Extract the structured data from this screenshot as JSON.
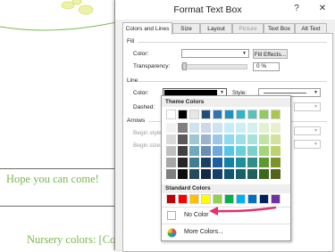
{
  "document": {
    "invite_text": "Hope you can come!",
    "bottom_text": "Nursery colors: [Colors"
  },
  "dialog": {
    "title": "Format Text Box",
    "help_glyph": "?",
    "close_glyph": "✕",
    "tabs": [
      {
        "label": "Colors and Lines",
        "active": true
      },
      {
        "label": "Size"
      },
      {
        "label": "Layout"
      },
      {
        "label": "Picture",
        "disabled": true
      },
      {
        "label": "Text Box"
      },
      {
        "label": "Alt Text"
      }
    ],
    "fill": {
      "section": "Fill",
      "color_label": "Color:",
      "fill_effects_label": "Fill Effects...",
      "transparency_label": "Transparency:",
      "transparency_value": "0 %",
      "transparency_fraction": 0
    },
    "line": {
      "section": "Line",
      "color_label": "Color:",
      "color_value": "#000000",
      "dashed_label": "Dashed:",
      "style_label": "Style:"
    },
    "arrows": {
      "section": "Arrows",
      "begin_style_label": "Begin style:",
      "begin_size_label": "Begin size:"
    }
  },
  "color_popup": {
    "theme_header": "Theme Colors",
    "theme_top_row": [
      "#ffffff",
      "#000000",
      "#e7e6e6",
      "#1f4e79",
      "#2e75b6",
      "#1e90c8",
      "#2fb5c8",
      "#5bc0be",
      "#8fcb5e",
      "#a9c84b"
    ],
    "theme_columns": [
      [
        "#f2f2f2",
        "#d9d9d9",
        "#bfbfbf",
        "#a6a6a6",
        "#7f7f7f"
      ],
      [
        "#7f7f7f",
        "#595959",
        "#404040",
        "#262626",
        "#0d0d0d"
      ],
      [
        "#cfe3ea",
        "#a0c6d4",
        "#6fa9be",
        "#3f7f95",
        "#244c5a"
      ],
      [
        "#cdd9e6",
        "#9bb3cd",
        "#6a8db4",
        "#1f3e63",
        "#132842"
      ],
      [
        "#cfe2f3",
        "#9fc5e8",
        "#6fa8dc",
        "#1e5fa1",
        "#143f6b"
      ],
      [
        "#c7ecf7",
        "#90d9ef",
        "#58c5e7",
        "#1581a6",
        "#0e566f"
      ],
      [
        "#cdeff3",
        "#9bdfe8",
        "#69cfdc",
        "#1f8f9e",
        "#155f69"
      ],
      [
        "#d3efee",
        "#a7e0dd",
        "#7bd0cc",
        "#2f8e8a",
        "#1f5f5c"
      ],
      [
        "#e1f1d2",
        "#c3e3a5",
        "#a5d578",
        "#5b9a2b",
        "#3d671d"
      ],
      [
        "#e9f0cf",
        "#d3e19f",
        "#bdd26f",
        "#7c932a",
        "#53621c"
      ]
    ],
    "standard_header": "Standard Colors",
    "standard": [
      "#c00000",
      "#ff0000",
      "#ffc000",
      "#ffff00",
      "#92d050",
      "#00b050",
      "#00b0f0",
      "#0070c0",
      "#002060",
      "#7030a0"
    ],
    "no_color_label": "No Color",
    "more_colors_label": "More Colors..."
  },
  "annotation": {
    "arrow_color": "#e0336b"
  }
}
